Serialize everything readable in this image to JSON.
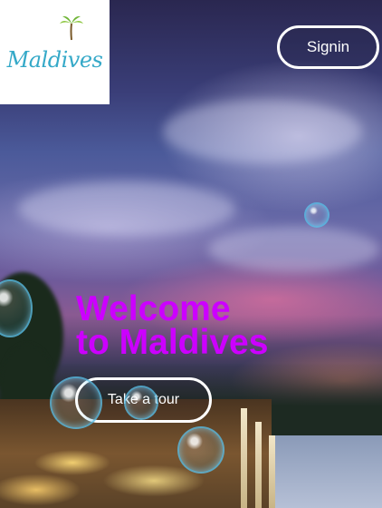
{
  "brand": {
    "logo_text": "Maldives"
  },
  "header": {
    "signin_label": "Signin"
  },
  "hero": {
    "title_line1": "Welcome",
    "title_line2": "to Maldives",
    "cta_label": "Take a tour"
  },
  "colors": {
    "title": "#cc00ff",
    "logo": "#35a9c8",
    "button_border": "#ffffff"
  }
}
